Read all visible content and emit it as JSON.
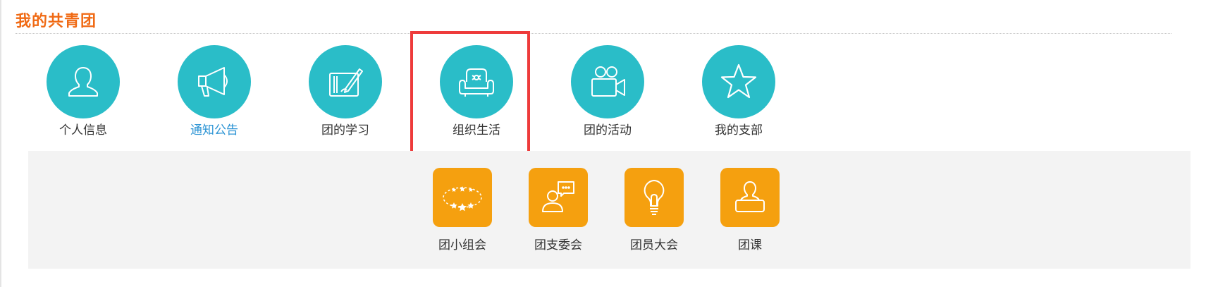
{
  "section": {
    "title": "我的共青团"
  },
  "top_nav": [
    {
      "label": "个人信息",
      "icon": "person-icon",
      "active": false
    },
    {
      "label": "通知公告",
      "icon": "megaphone-icon",
      "active": true
    },
    {
      "label": "团的学习",
      "icon": "pen-tablet-icon",
      "active": false
    },
    {
      "label": "组织生活",
      "icon": "armchair-icon",
      "active": false,
      "highlighted": true
    },
    {
      "label": "团的活动",
      "icon": "video-camera-icon",
      "active": false
    },
    {
      "label": "我的支部",
      "icon": "star-icon",
      "active": false
    }
  ],
  "sub_nav": [
    {
      "label": "团小组会",
      "icon": "star-ring-icon"
    },
    {
      "label": "团支委会",
      "icon": "speech-person-icon"
    },
    {
      "label": "团员大会",
      "icon": "lightbulb-icon"
    },
    {
      "label": "团课",
      "icon": "lecturer-icon"
    }
  ],
  "colors": {
    "title": "#f06a14",
    "teal": "#2abdc8",
    "orange": "#f5a00f",
    "active_link": "#2a93d4",
    "highlight_border": "#ee3b3b",
    "panel_bg": "#f3f3f3"
  }
}
